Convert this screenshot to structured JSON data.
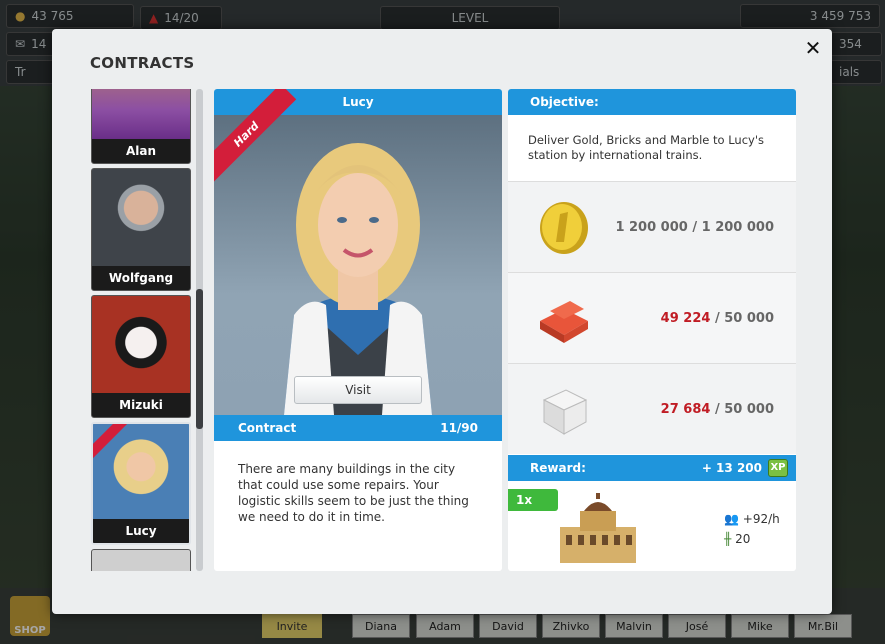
{
  "hud": {
    "money_left": "43 765",
    "trains": "14/20",
    "level_label": "LEVEL",
    "money_right": "3 459 753",
    "left_row2": "14",
    "right_row2": "354",
    "left_row3": "Tr",
    "right_row3": "ials"
  },
  "bottom": {
    "invite_label": "Invite",
    "players": [
      "Diana",
      "Adam",
      "David",
      "Zhivko",
      "Malvin",
      "José",
      "Mike",
      "Mr.Bil"
    ],
    "shop_label": "SHOP"
  },
  "modal": {
    "title": "CONTRACTS",
    "close_icon": "close-icon"
  },
  "contacts": [
    {
      "name": "Alan"
    },
    {
      "name": "Wolfgang"
    },
    {
      "name": "Mizuki"
    },
    {
      "name": "Lucy",
      "selected": true,
      "badge": "Hard"
    },
    {
      "name": ""
    }
  ],
  "contract": {
    "name": "Lucy",
    "difficulty": "Hard",
    "visit_label": "Visit",
    "contract_label": "Contract",
    "progress": "11/90",
    "description": "There are many buildings in the city that could use some repairs. Your logistic skills seem to be just the thing we need to do it in time."
  },
  "objective": {
    "header": "Objective:",
    "text": "Deliver Gold, Bricks and Marble to Lucy's station by international trains.",
    "items": [
      {
        "icon": "gold-coin-icon",
        "current": "1 200 000",
        "target": "1 200 000",
        "complete": true
      },
      {
        "icon": "bricks-icon",
        "current": "49 224",
        "target": "50 000",
        "complete": false
      },
      {
        "icon": "marble-icon",
        "current": "27 684",
        "target": "50 000",
        "complete": false
      }
    ]
  },
  "reward": {
    "label": "Reward:",
    "xp": "+ 13 200",
    "xp_badge": "XP",
    "multiplier": "1x",
    "passengers": "+92/h",
    "capacity": "20"
  }
}
